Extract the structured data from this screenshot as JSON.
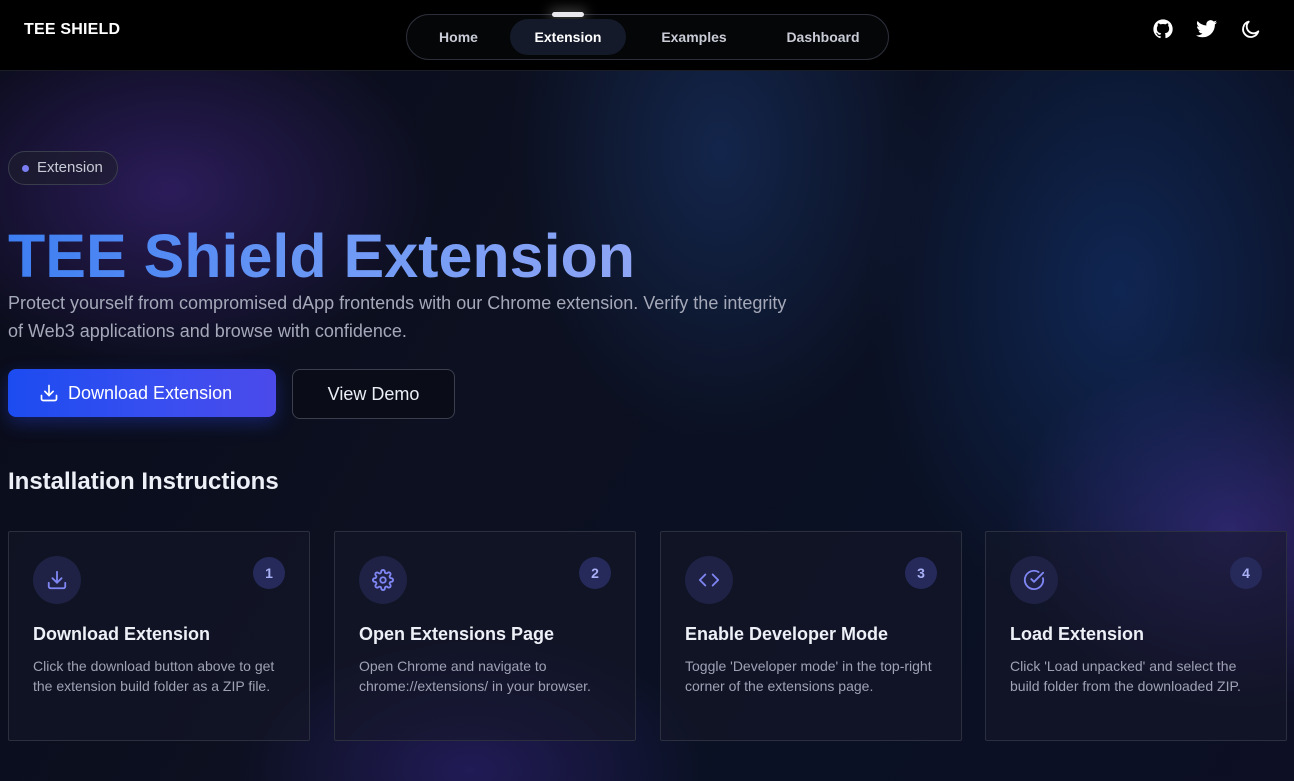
{
  "header": {
    "brand": "TEE SHIELD",
    "nav": [
      {
        "label": "Home",
        "active": false
      },
      {
        "label": "Extension",
        "active": true
      },
      {
        "label": "Examples",
        "active": false
      },
      {
        "label": "Dashboard",
        "active": false
      }
    ],
    "icons": [
      "github-icon",
      "twitter-icon",
      "moon-icon"
    ]
  },
  "hero": {
    "badge": "Extension",
    "title": "TEE Shield Extension",
    "subtitle": "Protect yourself from compromised dApp frontends with our Chrome extension. Verify the integrity of Web3 applications and browse with confidence.",
    "primary_button": "Download Extension",
    "secondary_button": "View Demo"
  },
  "instructions": {
    "title": "Installation Instructions",
    "steps": [
      {
        "number": "1",
        "icon": "download-icon",
        "title": "Download Extension",
        "description": "Click the download button above to get the extension build folder as a ZIP file."
      },
      {
        "number": "2",
        "icon": "settings-icon",
        "title": "Open Extensions Page",
        "description": "Open Chrome and navigate to chrome://extensions/ in your browser."
      },
      {
        "number": "3",
        "icon": "code-icon",
        "title": "Enable Developer Mode",
        "description": "Toggle 'Developer mode' in the top-right corner of the extensions page."
      },
      {
        "number": "4",
        "icon": "check-circle-icon",
        "title": "Load Extension",
        "description": "Click 'Load unpacked' and select the build folder from the downloaded ZIP."
      }
    ]
  },
  "colors": {
    "accent": "#3a4ef0",
    "title_gradient_start": "#3d7ef2",
    "title_gradient_end": "#8ea5f5",
    "step_icon": "#7f86f3"
  }
}
